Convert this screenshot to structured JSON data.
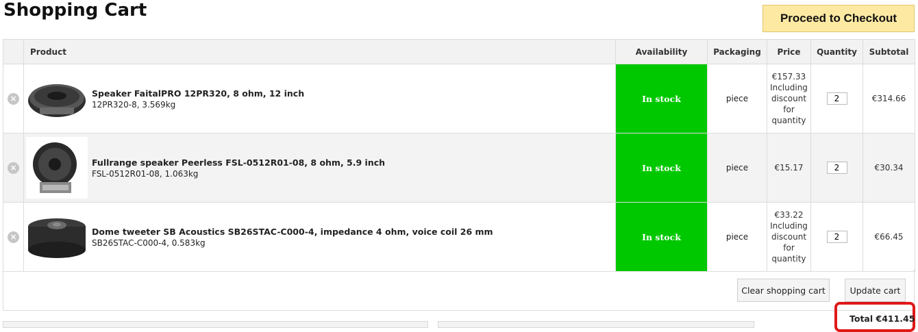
{
  "page": {
    "title": "Shopping Cart",
    "checkout_label": "Proceed to Checkout"
  },
  "table": {
    "headers": {
      "product": "Product",
      "availability": "Availability",
      "packaging": "Packaging",
      "price": "Price",
      "quantity": "Quantity",
      "subtotal": "Subtotal"
    },
    "rows": [
      {
        "name": "Speaker FaitalPRO 12PR320, 8 ohm, 12 inch",
        "meta": "12PR320-8, 3.569kg",
        "availability": "In stock",
        "packaging": "piece",
        "price_lines": [
          "€157.33",
          "Including",
          "discount",
          "for",
          "quantity"
        ],
        "quantity": "2",
        "subtotal": "€314.66"
      },
      {
        "name": "Fullrange speaker Peerless FSL-0512R01-08, 8 ohm, 5.9 inch",
        "meta": "FSL-0512R01-08, 1.063kg",
        "availability": "In stock",
        "packaging": "piece",
        "price_lines": [
          "€15.17"
        ],
        "quantity": "2",
        "subtotal": "€30.34"
      },
      {
        "name": "Dome tweeter SB Acoustics SB26STAC-C000-4, impedance 4 ohm, voice coil 26 mm",
        "meta": "SB26STAC-C000-4, 0.583kg",
        "availability": "In stock",
        "packaging": "piece",
        "price_lines": [
          "€33.22",
          "Including",
          "discount",
          "for",
          "quantity"
        ],
        "quantity": "2",
        "subtotal": "€66.45"
      }
    ]
  },
  "actions": {
    "clear_label": "Clear shopping cart",
    "update_label": "Update cart"
  },
  "summary": {
    "total_label": "Total €411.45"
  },
  "colors": {
    "in_stock": "#00c800",
    "checkout_bg": "#fde9a2",
    "highlight": "#e01818"
  },
  "icons": {
    "remove": "remove-circle-icon"
  }
}
